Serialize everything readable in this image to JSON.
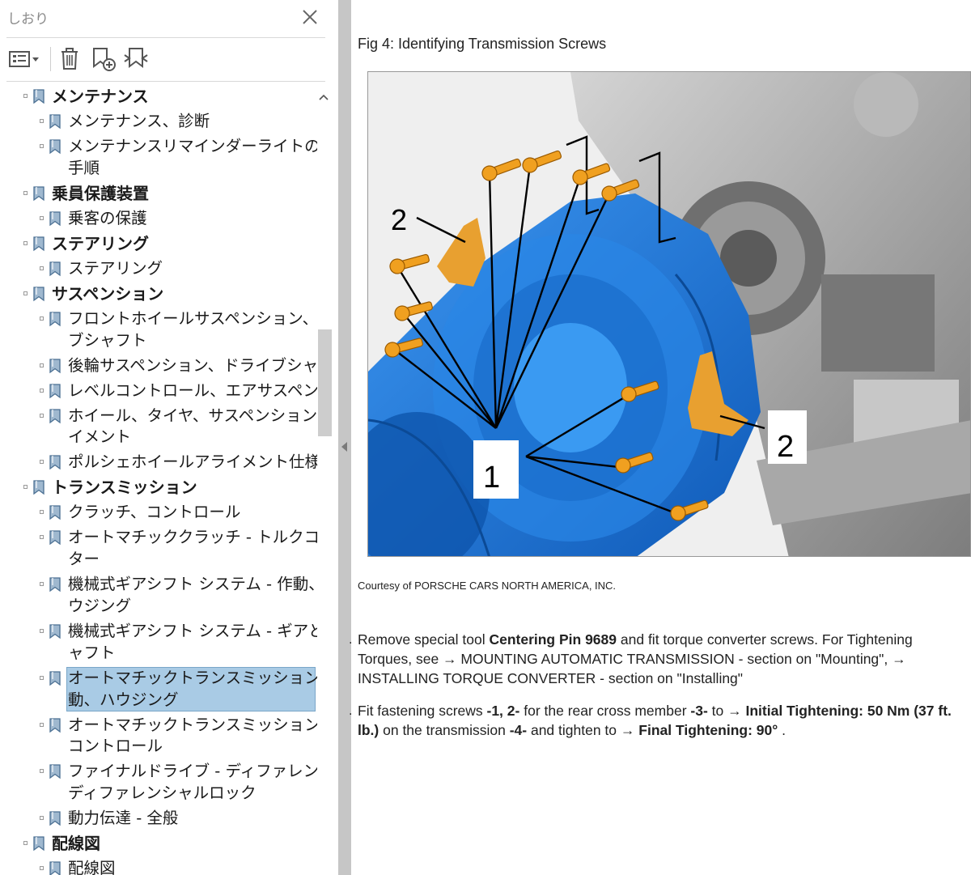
{
  "panel": {
    "title": "しおり",
    "toolbar": {
      "options_icon": "options-list-icon",
      "delete_icon": "trash-icon",
      "new_bookmark_icon": "new-bookmark-icon",
      "expand_icon": "expand-bookmark-icon"
    },
    "items": [
      {
        "level": 1,
        "lines": [
          "メンテナンス"
        ]
      },
      {
        "level": 2,
        "lines": [
          "メンテナンス、診断"
        ]
      },
      {
        "level": 2,
        "lines": [
          "メンテナンスリマインダーライトのリセット",
          "手順"
        ]
      },
      {
        "level": 1,
        "lines": [
          "乗員保護装置"
        ]
      },
      {
        "level": 2,
        "lines": [
          "乗客の保護"
        ]
      },
      {
        "level": 1,
        "lines": [
          "ステアリング"
        ]
      },
      {
        "level": 2,
        "lines": [
          "ステアリング"
        ]
      },
      {
        "level": 1,
        "lines": [
          "サスペンション"
        ]
      },
      {
        "level": 2,
        "lines": [
          "フロントホイールサスペンション、ドライ",
          "ブシャフト"
        ]
      },
      {
        "level": 2,
        "lines": [
          "後輪サスペンション、ドライブシャフト"
        ]
      },
      {
        "level": 2,
        "lines": [
          "レベルコントロール、エアサスペンション"
        ]
      },
      {
        "level": 2,
        "lines": [
          "ホイール、タイヤ、サスペンションのアラ",
          "イメント"
        ]
      },
      {
        "level": 2,
        "lines": [
          "ポルシェホイールアライメント仕様"
        ]
      },
      {
        "level": 1,
        "lines": [
          "トランスミッション"
        ]
      },
      {
        "level": 2,
        "lines": [
          "クラッチ、コントロール"
        ]
      },
      {
        "level": 2,
        "lines": [
          "オートマチッククラッチ - トルクコンバー",
          "ター"
        ]
      },
      {
        "level": 2,
        "lines": [
          "機械式ギアシフト システム - 作動、ハ",
          "ウジング"
        ]
      },
      {
        "level": 2,
        "lines": [
          "機械式ギアシフト システム - ギアとシ",
          "ャフト"
        ]
      },
      {
        "level": 2,
        "lines": [
          "オートマチックトランスミッション - 作",
          "動、ハウジング"
        ],
        "selected": true
      },
      {
        "level": 2,
        "lines": [
          "オートマチックトランスミッション - ギア、",
          "コントロール"
        ]
      },
      {
        "level": 2,
        "lines": [
          "ファイナルドライブ - ディファレンシャル、",
          "ディファレンシャルロック"
        ]
      },
      {
        "level": 2,
        "lines": [
          "動力伝達 - 全般"
        ]
      },
      {
        "level": 1,
        "lines": [
          "配線図"
        ]
      },
      {
        "level": 2,
        "lines": [
          "配線図"
        ]
      }
    ]
  },
  "document": {
    "fig_title": "Fig 4: Identifying Transmission Screws",
    "figure": {
      "callouts": [
        "2",
        "1",
        "2"
      ],
      "colors": {
        "transmission": "#1e7ee0",
        "screw": "#f0a020",
        "bracket": "#e8a030",
        "engine": "#8c8c8c"
      }
    },
    "courtesy": "Courtesy of PORSCHE CARS NORTH AMERICA, INC.",
    "para1": {
      "t1": "Remove special tool ",
      "b1": "Centering Pin 9689",
      "t2": "  and fit torque converter screws. For Tightening Torques, see → MOUNTING AUTOMATIC TRANSMISSION  - section on \"Mounting\", → INSTALLING TORQUE CONVERTER - section on \"Installing\""
    },
    "para2": {
      "t1": "Fit fastening screws ",
      "b1": "-1, 2-",
      "t2": "  for the rear cross member ",
      "b2": "-3-",
      "t3": "  to → ",
      "b3": "Initial Tightening: 50 Nm (37 ft. lb.)",
      "t4": "  on the transmission ",
      "b4": "-4-",
      "t5": "  and tighten to → ",
      "b5": "Final Tightening: 90°",
      "t6": "  ."
    }
  }
}
